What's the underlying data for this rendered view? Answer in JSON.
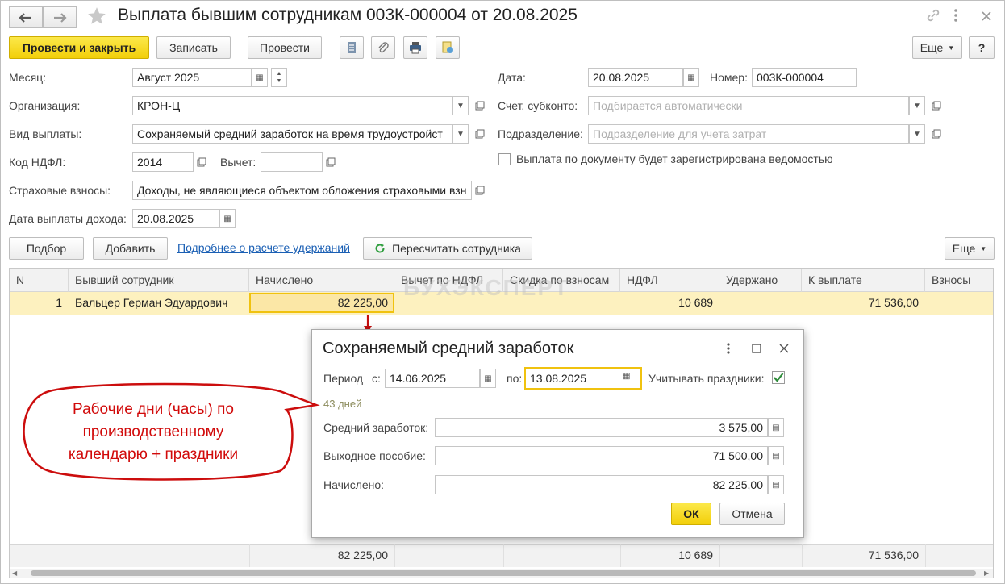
{
  "window": {
    "title": "Выплата бывшим сотрудникам 003К-000004 от 20.08.2025",
    "back_icon": "arrow-left-icon",
    "forward_icon": "arrow-right-icon",
    "favorite_icon": "star-icon",
    "link_icon": "link-icon",
    "menu_icon": "kebab-icon",
    "close_icon": "close-icon"
  },
  "toolbar": {
    "post_close": "Провести и закрыть",
    "save": "Записать",
    "post": "Провести",
    "more": "Еще",
    "help": "?"
  },
  "form": {
    "month_label": "Месяц:",
    "month_value": "Август 2025",
    "org_label": "Организация:",
    "org_value": "КРОН-Ц",
    "pay_type_label": "Вид выплаты:",
    "pay_type_value": "Сохраняемый средний заработок на время трудоустройст",
    "ndfl_code_label": "Код НДФЛ:",
    "ndfl_code_value": "2014",
    "deduction_label": "Вычет:",
    "deduction_value": "",
    "insurance_label": "Страховые взносы:",
    "insurance_value": "Доходы, не являющиеся объектом обложения страховыми взн",
    "pay_date_label": "Дата выплаты дохода:",
    "pay_date_value": "20.08.2025",
    "date_label": "Дата:",
    "date_value": "20.08.2025",
    "number_label": "Номер:",
    "number_value": "003К-000004",
    "account_label": "Счет, субконто:",
    "account_placeholder": "Подбирается автоматически",
    "dept_label": "Подразделение:",
    "dept_placeholder": "Подразделение для учета затрат",
    "statement_checkbox_label": "Выплата по документу будет зарегистрирована ведомостью",
    "statement_checked": false
  },
  "table_toolbar": {
    "select": "Подбор",
    "add": "Добавить",
    "details_link": "Подробнее о расчете удержаний",
    "recalc": "Пересчитать сотрудника",
    "more": "Еще"
  },
  "table": {
    "columns": [
      "N",
      "Бывший сотрудник",
      "Начислено",
      "Вычет по НДФЛ",
      "Скидка по взносам",
      "НДФЛ",
      "Удержано",
      "К выплате",
      "Взносы"
    ],
    "rows": [
      {
        "n": "1",
        "employee": "Бальцер Герман Эдуардович",
        "accrued": "82 225,00",
        "deduction": "",
        "discount": "",
        "ndfl": "10 689",
        "withheld": "",
        "to_pay": "71 536,00",
        "contrib": ""
      }
    ],
    "totals": {
      "accrued": "82 225,00",
      "ndfl": "10 689",
      "to_pay": "71 536,00"
    }
  },
  "watermark": "БУХЭКСПЕРТ",
  "dialog": {
    "title": "Сохраняемый средний заработок",
    "period_label": "Период",
    "from_label": "с:",
    "from_value": "14.06.2025",
    "to_label": "по:",
    "to_value": "13.08.2025",
    "holidays_label": "Учитывать праздники:",
    "holidays_checked": true,
    "days_text": "43 дней",
    "avg_label": "Средний заработок:",
    "avg_value": "3 575,00",
    "severance_label": "Выходное пособие:",
    "severance_value": "71 500,00",
    "accrued_label": "Начислено:",
    "accrued_value": "82 225,00",
    "ok": "ОК",
    "cancel": "Отмена"
  },
  "callout": {
    "line1": "Рабочие дни (часы) по",
    "line2": "производственному",
    "line3": "календарю + праздники",
    "color": "#d10a0a"
  },
  "colors": {
    "primary_button": "#f5d20f",
    "selected_row": "#fdf1bf",
    "link": "#1a5fb4",
    "focus_border": "#f0c20f"
  }
}
